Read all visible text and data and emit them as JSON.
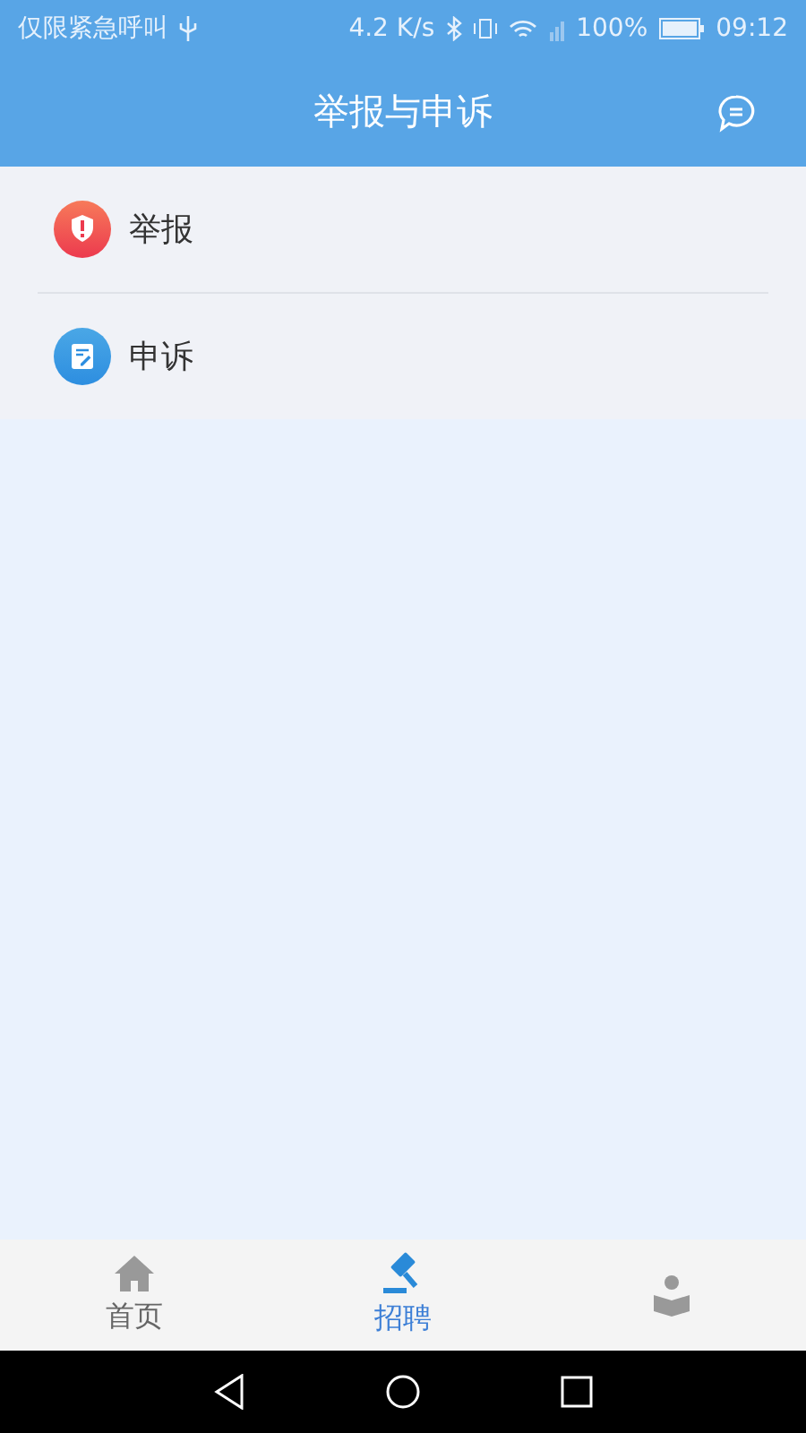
{
  "status_bar": {
    "carrier": "仅限紧急呼叫",
    "speed": "4.2 K/s",
    "battery": "100%",
    "time": "09:12"
  },
  "header": {
    "title": "举报与申诉"
  },
  "menu": [
    {
      "label": "举报",
      "kind": "report"
    },
    {
      "label": "申诉",
      "kind": "appeal"
    }
  ],
  "tabs": [
    {
      "label": "首页",
      "kind": "home",
      "selected": false
    },
    {
      "label": "招聘",
      "kind": "gavel",
      "selected": true
    },
    {
      "kind": "reader",
      "selected": false
    }
  ]
}
